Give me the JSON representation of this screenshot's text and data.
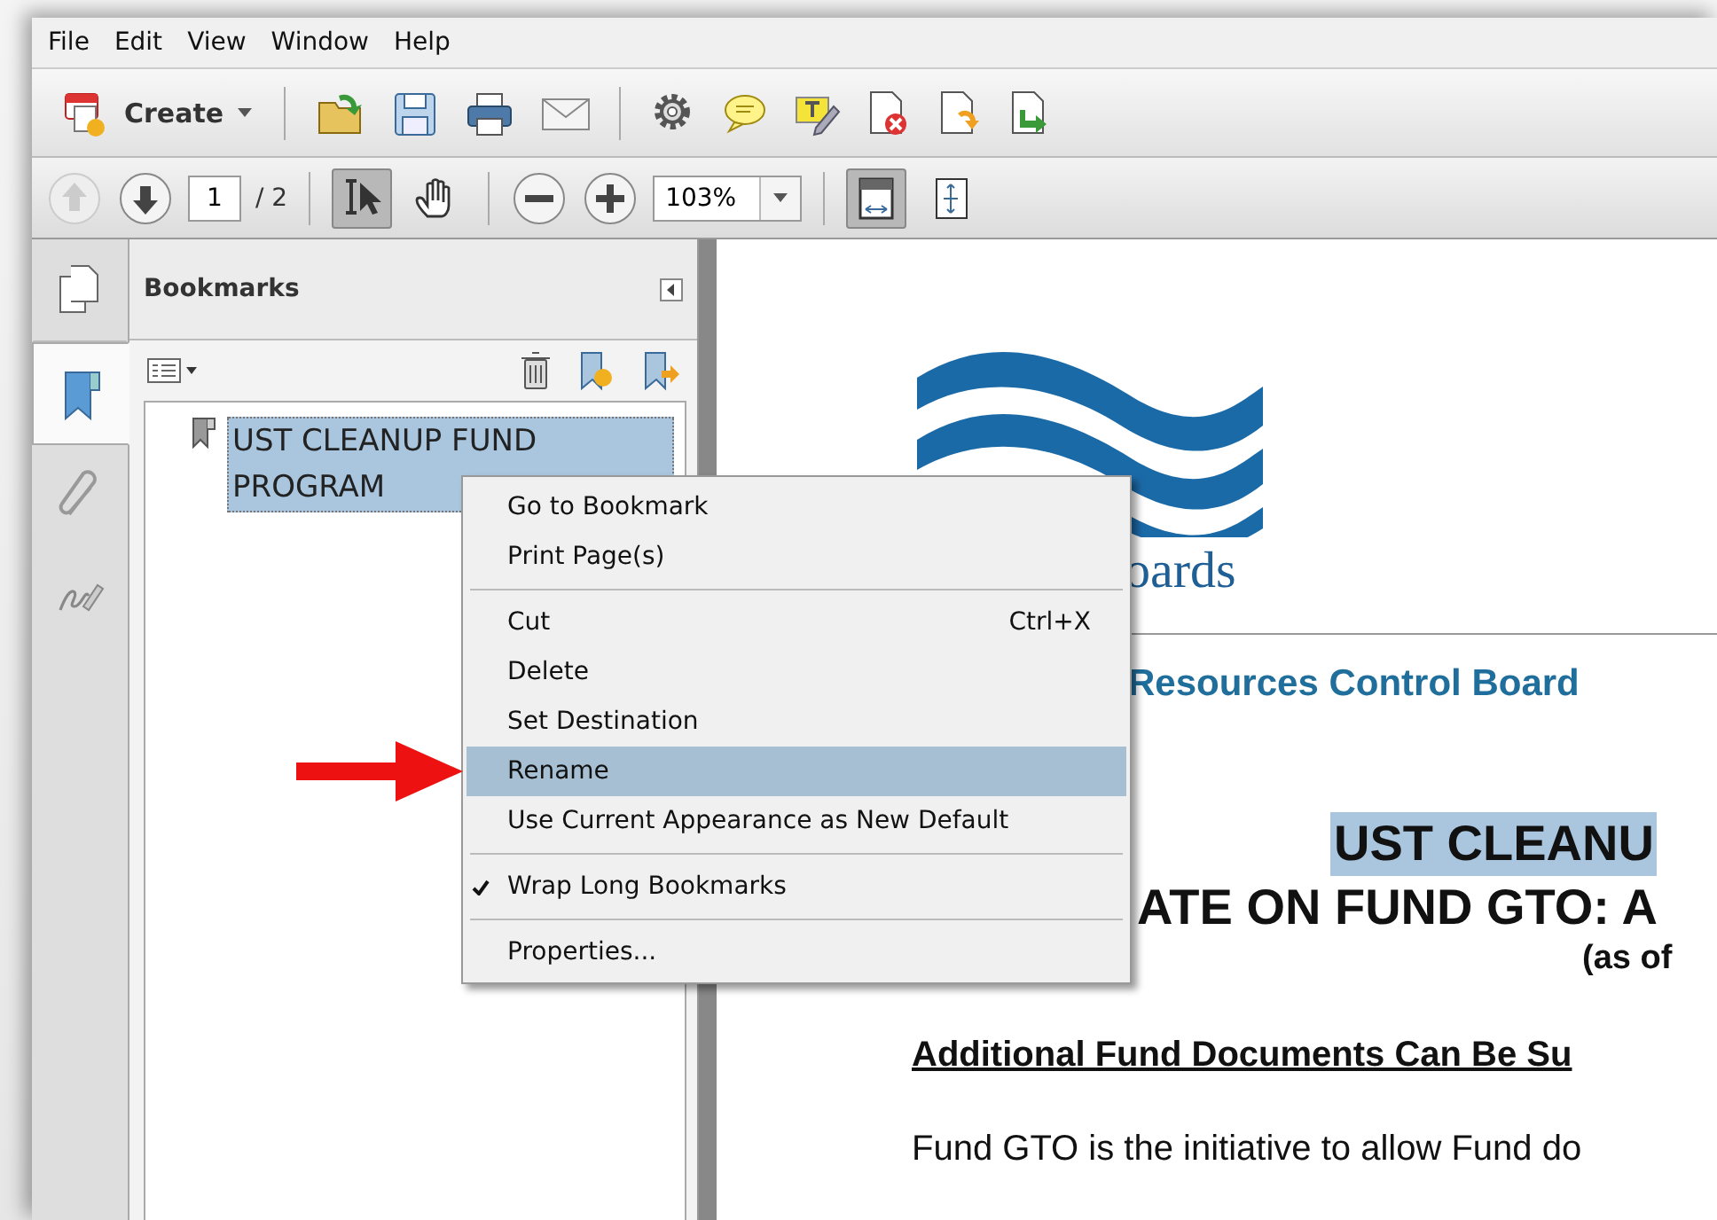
{
  "menu_bar": [
    {
      "label": "File"
    },
    {
      "label": "Edit"
    },
    {
      "label": "View"
    },
    {
      "label": "Window"
    },
    {
      "label": "Help"
    }
  ],
  "toolbar": {
    "create_label": "Create"
  },
  "navigation": {
    "previous_disabled": true,
    "next_disabled": false,
    "page_number": "1",
    "page_count": "/ 2",
    "zoom": "103%",
    "tools": [
      {
        "kind": "select",
        "selected": true
      },
      {
        "kind": "hand",
        "selected": false
      }
    ],
    "views": [
      {
        "kind": "fit-page",
        "selected": true
      },
      {
        "kind": "full-screen",
        "selected": false
      }
    ]
  },
  "side_tabs": [
    {
      "kind": "pages",
      "selected": false
    },
    {
      "kind": "bookmarks",
      "selected": true
    },
    {
      "kind": "attachments",
      "selected": false
    },
    {
      "kind": "signatures",
      "selected": false
    }
  ],
  "bookmarks_panel": {
    "title": "Bookmarks",
    "items": [
      {
        "label": "UST CLEANUP FUND PROGRAM",
        "selected": true
      }
    ]
  },
  "context_menu": {
    "groups": [
      [
        {
          "label": "Go to Bookmark",
          "checked": false,
          "selected": false
        },
        {
          "label": "Print Page(s)",
          "checked": false,
          "selected": false
        }
      ],
      [
        {
          "label": "Cut",
          "shortcut": "Ctrl+X",
          "checked": false,
          "selected": false
        },
        {
          "label": "Delete",
          "checked": false,
          "selected": false
        },
        {
          "label": "Set Destination",
          "checked": false,
          "selected": false
        },
        {
          "label": "Rename",
          "checked": false,
          "selected": true
        },
        {
          "label": "Use Current Appearance as New Default",
          "checked": false,
          "selected": false
        }
      ],
      [
        {
          "label": "Wrap Long Bookmarks",
          "checked": true,
          "selected": false
        }
      ],
      [
        {
          "label": "Properties...",
          "checked": false,
          "selected": false
        }
      ]
    ]
  },
  "document": {
    "logo_text": "oards",
    "organization": "Resources Control Board",
    "title_lines": [
      {
        "text": "UST CLEANU",
        "highlighted": true
      },
      {
        "text": "ATE ON FUND GTO: A",
        "highlighted": false
      }
    ],
    "date": "(as of",
    "heading": "Additional Fund Documents Can Be Su",
    "body": "Fund GTO is the initiative to allow Fund do"
  }
}
